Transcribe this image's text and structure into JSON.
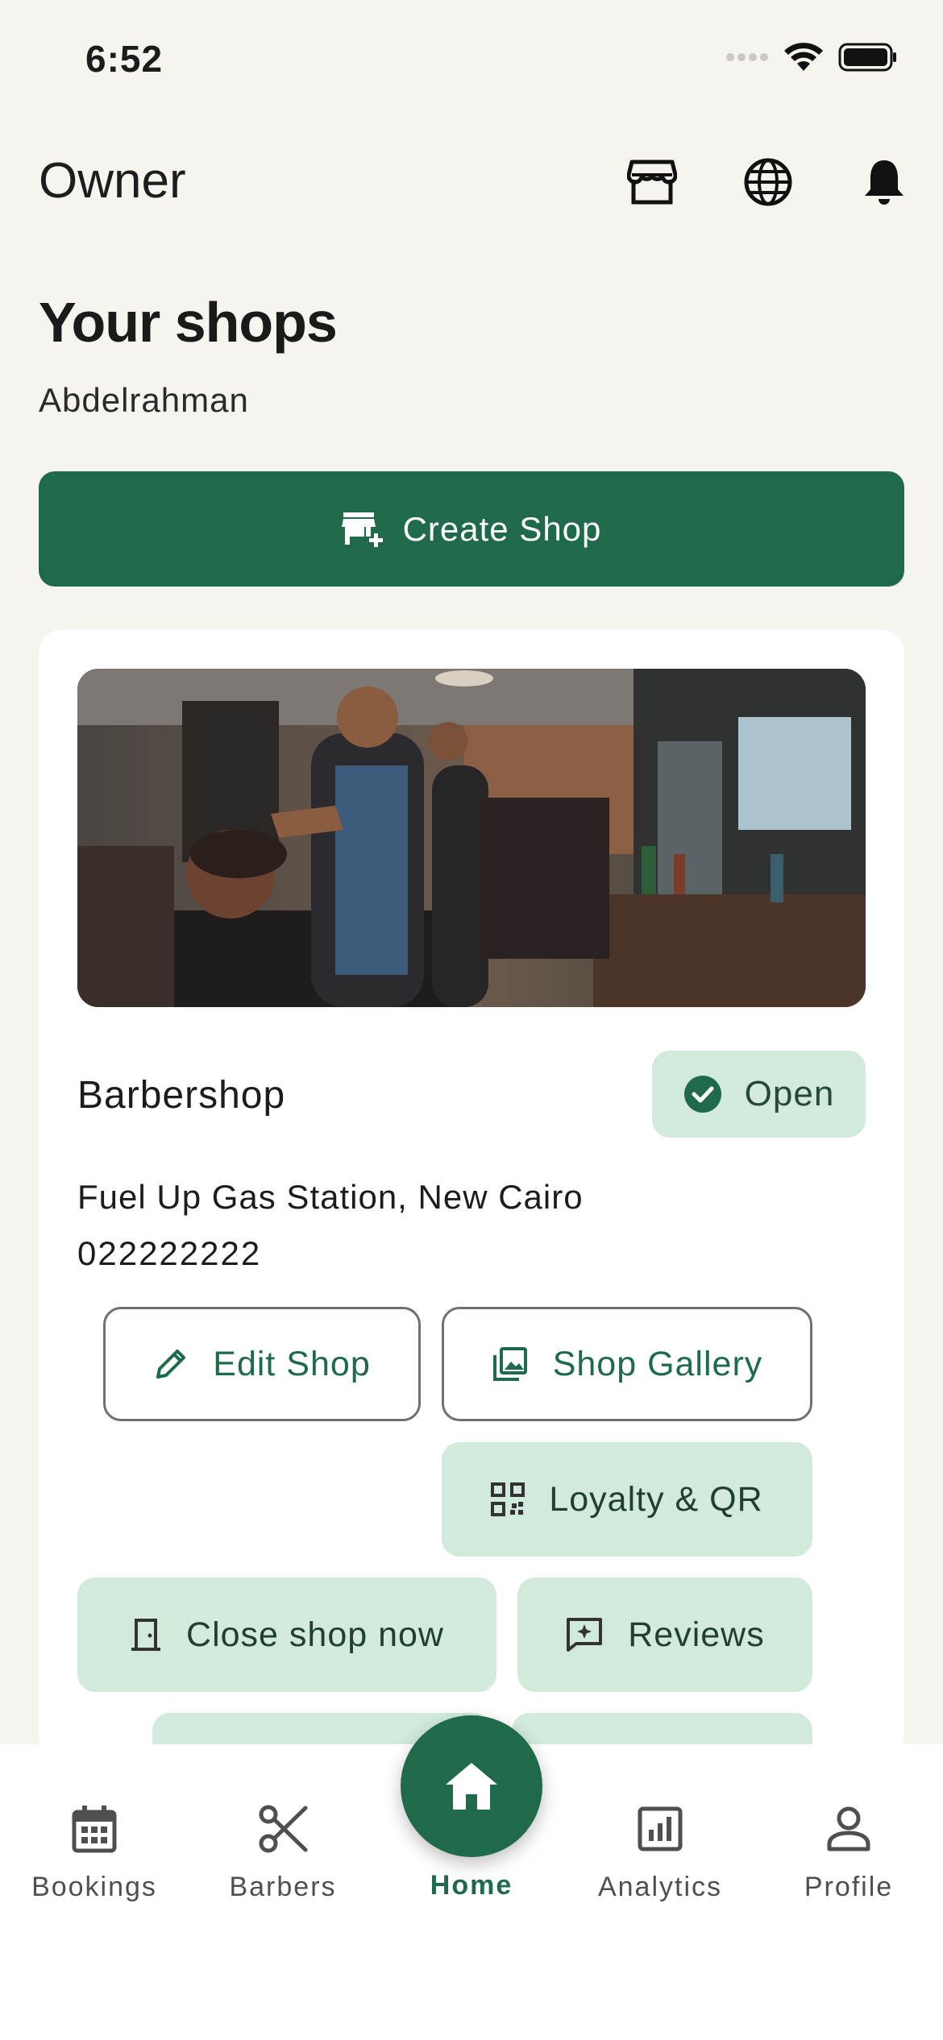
{
  "status_bar": {
    "time": "6:52"
  },
  "header": {
    "title": "Owner"
  },
  "page": {
    "title": "Your shops",
    "subtitle": "Abdelrahman"
  },
  "create_button": {
    "label": "Create Shop"
  },
  "shop": {
    "name": "Barbershop",
    "status": "Open",
    "address": "Fuel Up Gas Station, New Cairo",
    "phone": "022222222",
    "actions": {
      "edit": "Edit Shop",
      "gallery": "Shop Gallery",
      "loyalty": "Loyalty & QR",
      "close": "Close shop now",
      "reviews": "Reviews"
    }
  },
  "nav": {
    "bookings": "Bookings",
    "barbers": "Barbers",
    "home": "Home",
    "analytics": "Analytics",
    "profile": "Profile"
  },
  "colors": {
    "brand": "#1e6a4b",
    "badge_bg": "#d2eadb",
    "background": "#f6f4ee"
  },
  "icons": [
    "storefront-icon",
    "globe-icon",
    "bell-icon",
    "add-store-icon",
    "check-circle-icon",
    "pencil-icon",
    "image-icon",
    "qr-code-icon",
    "door-icon",
    "review-icon",
    "calendar-icon",
    "scissors-icon",
    "home-icon",
    "analytics-icon",
    "person-icon"
  ]
}
